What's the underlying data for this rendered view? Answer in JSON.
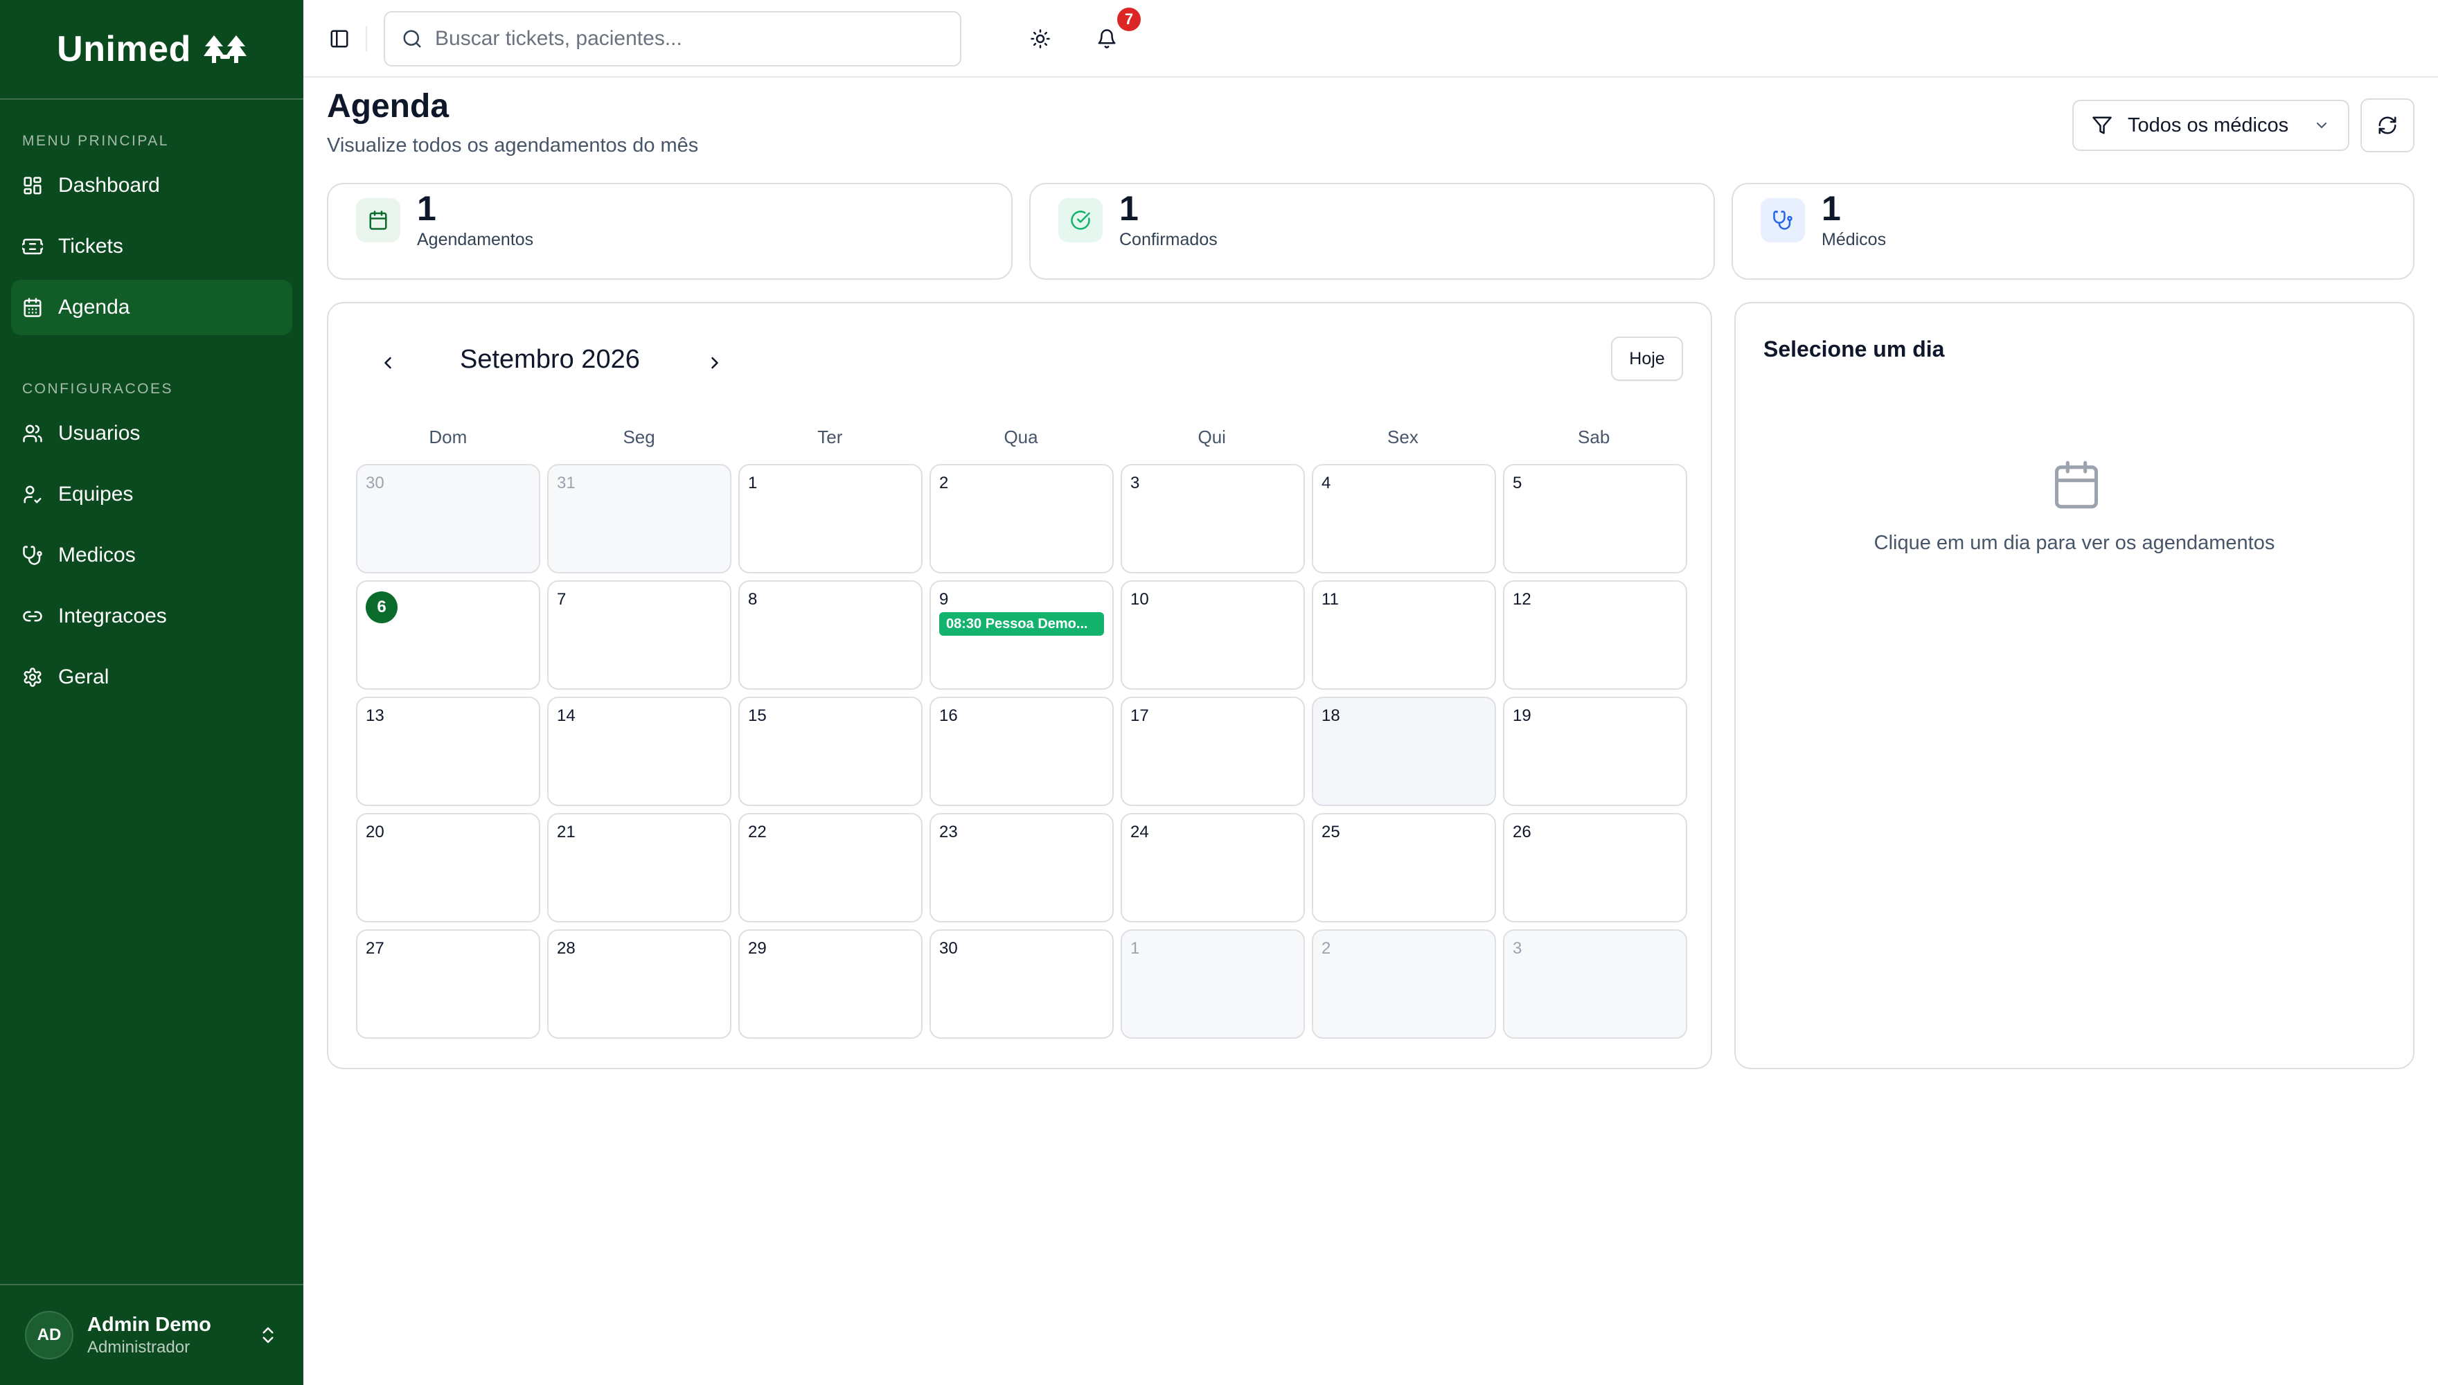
{
  "brand": {
    "name": "Unimed"
  },
  "sidebar": {
    "sections": [
      {
        "label": "MENU PRINCIPAL",
        "items": [
          {
            "label": "Dashboard",
            "icon": "dashboard-icon"
          },
          {
            "label": "Tickets",
            "icon": "ticket-icon"
          },
          {
            "label": "Agenda",
            "icon": "calendar-icon",
            "active": true
          }
        ]
      },
      {
        "label": "CONFIGURACOES",
        "items": [
          {
            "label": "Usuarios",
            "icon": "users-icon"
          },
          {
            "label": "Equipes",
            "icon": "team-icon"
          },
          {
            "label": "Medicos",
            "icon": "stethoscope-icon"
          },
          {
            "label": "Integracoes",
            "icon": "link-icon"
          },
          {
            "label": "Geral",
            "icon": "gear-icon"
          }
        ]
      }
    ]
  },
  "user": {
    "initials": "AD",
    "name": "Admin Demo",
    "role": "Administrador"
  },
  "topbar": {
    "search_placeholder": "Buscar tickets, pacientes...",
    "notification_count": "7"
  },
  "header": {
    "title": "Agenda",
    "subtitle": "Visualize todos os agendamentos do mês"
  },
  "filter": {
    "label": "Todos os médicos"
  },
  "stats": [
    {
      "value": "1",
      "label": "Agendamentos",
      "icon": "calendar-icon",
      "color": "#0b6b2b",
      "bg": "#e9f5ec"
    },
    {
      "value": "1",
      "label": "Confirmados",
      "icon": "check-circle-icon",
      "color": "#13b36e",
      "bg": "#e6f7ef"
    },
    {
      "value": "1",
      "label": "Médicos",
      "icon": "stethoscope-icon",
      "color": "#2563eb",
      "bg": "#e8efff"
    }
  ],
  "calendar": {
    "month_label": "Setembro 2026",
    "today_label": "Hoje",
    "weekdays": [
      "Dom",
      "Seg",
      "Ter",
      "Qua",
      "Qui",
      "Sex",
      "Sab"
    ],
    "days": [
      {
        "n": "30",
        "outside": true
      },
      {
        "n": "31",
        "outside": true
      },
      {
        "n": "1"
      },
      {
        "n": "2"
      },
      {
        "n": "3"
      },
      {
        "n": "4"
      },
      {
        "n": "5"
      },
      {
        "n": "6",
        "today": true
      },
      {
        "n": "7"
      },
      {
        "n": "8"
      },
      {
        "n": "9",
        "event": "08:30 Pessoa Demo..."
      },
      {
        "n": "10"
      },
      {
        "n": "11"
      },
      {
        "n": "12"
      },
      {
        "n": "13"
      },
      {
        "n": "14"
      },
      {
        "n": "15"
      },
      {
        "n": "16"
      },
      {
        "n": "17"
      },
      {
        "n": "18",
        "selected": true
      },
      {
        "n": "19"
      },
      {
        "n": "20"
      },
      {
        "n": "21"
      },
      {
        "n": "22"
      },
      {
        "n": "23"
      },
      {
        "n": "24"
      },
      {
        "n": "25"
      },
      {
        "n": "26"
      },
      {
        "n": "27"
      },
      {
        "n": "28"
      },
      {
        "n": "29"
      },
      {
        "n": "30"
      },
      {
        "n": "1",
        "outside": true
      },
      {
        "n": "2",
        "outside": true
      },
      {
        "n": "3",
        "outside": true
      }
    ]
  },
  "day_panel": {
    "title": "Selecione um dia",
    "empty_text": "Clique em um dia para ver os agendamentos"
  },
  "colors": {
    "sidebar_bg": "#0b4a1f",
    "sidebar_active": "#125c28",
    "today": "#0b6b2b",
    "event": "#13b36e",
    "badge": "#dc2626"
  }
}
